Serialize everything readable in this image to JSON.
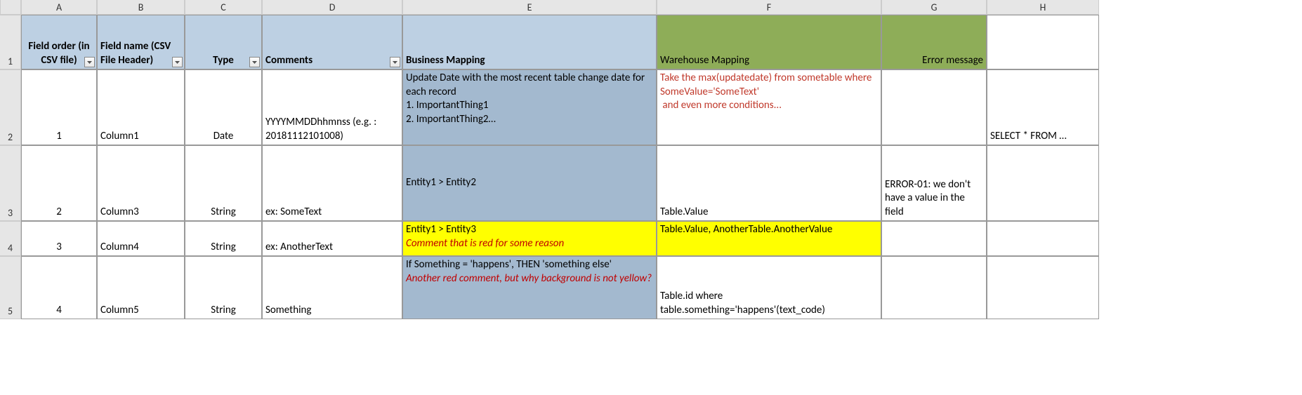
{
  "colHeaders": [
    "A",
    "B",
    "C",
    "D",
    "E",
    "F",
    "G",
    "H"
  ],
  "rowHeaders": [
    "1",
    "2",
    "3",
    "4",
    "5"
  ],
  "headers": {
    "A": "Field order (in CSV file)",
    "B": "Field name (CSV File Header)",
    "C": "Type",
    "D": "Comments",
    "E": "Business Mapping",
    "F": "Warehouse Mapping",
    "G": "Error message",
    "H": ""
  },
  "rows": [
    {
      "A": "1",
      "B": "Column1",
      "C": "Date",
      "D": "YYYYMMDDhhmnss (e.g. : 20181112101008)",
      "E": "Update Date with the most recent table change date for each record\n1. ImportantThing1\n2. ImportantThing2…",
      "F": "Take the max(updatedate) from sometable where SomeValue='SomeText'\n and even more conditions...",
      "G": "",
      "H": "SELECT * FROM …"
    },
    {
      "A": "2",
      "B": "Column3",
      "C": "String",
      "D": "ex: SomeText",
      "E": "Entity1 > Entity2",
      "F": "Table.Value",
      "G": "ERROR-01: we don't have a value in the field",
      "H": ""
    },
    {
      "A": "3",
      "B": "Column4",
      "C": "String",
      "D": "ex: AnotherText",
      "E_main": "Entity1 > Entity3",
      "E_note": "Comment that is red for some reason",
      "F": "Table.Value, AnotherTable.AnotherValue",
      "G": "",
      "H": ""
    },
    {
      "A": "4",
      "B": "Column5",
      "C": "String",
      "D": "Something",
      "E_main": "If Something = 'happens', THEN 'something else'",
      "E_note": "Another red comment, but why background is not yellow?",
      "F": "Table.id where table.something='happens'(text_code)",
      "G": "",
      "H": ""
    }
  ]
}
